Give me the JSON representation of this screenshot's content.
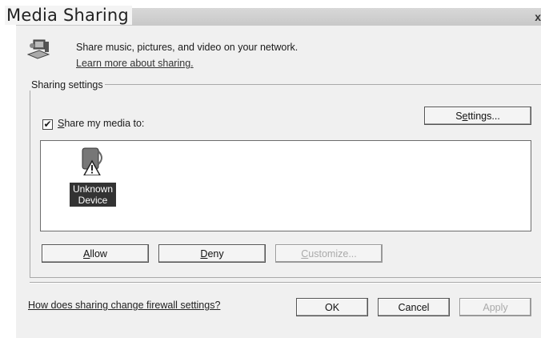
{
  "window": {
    "title": "Media Sharing",
    "close_glyph": "x"
  },
  "header": {
    "icon": "share-media-icon",
    "description": "Share music, pictures, and video on your network.",
    "learn_more_link": "Learn more about sharing."
  },
  "sharing_settings": {
    "group_label": "Sharing settings",
    "share_checkbox": {
      "checked": true,
      "label_accesskey": "S",
      "label_rest": "hare my media to:"
    },
    "settings_button": {
      "pre": "S",
      "accesskey": "e",
      "post": "ttings..."
    },
    "devices": [
      {
        "label": "Unknown\nDevice",
        "icon": "unknown-device-warning-icon",
        "selected": true
      }
    ],
    "allow_button": {
      "accesskey": "A",
      "rest": "llow",
      "enabled": true
    },
    "deny_button": {
      "accesskey": "D",
      "rest": "eny",
      "enabled": true
    },
    "customize_button": {
      "accesskey": "C",
      "rest": "ustomize...",
      "enabled": false
    }
  },
  "footer": {
    "firewall_link": "How does sharing change firewall settings?",
    "ok_label": "OK",
    "cancel_label": "Cancel",
    "apply_label": "Apply",
    "apply_enabled": false
  }
}
